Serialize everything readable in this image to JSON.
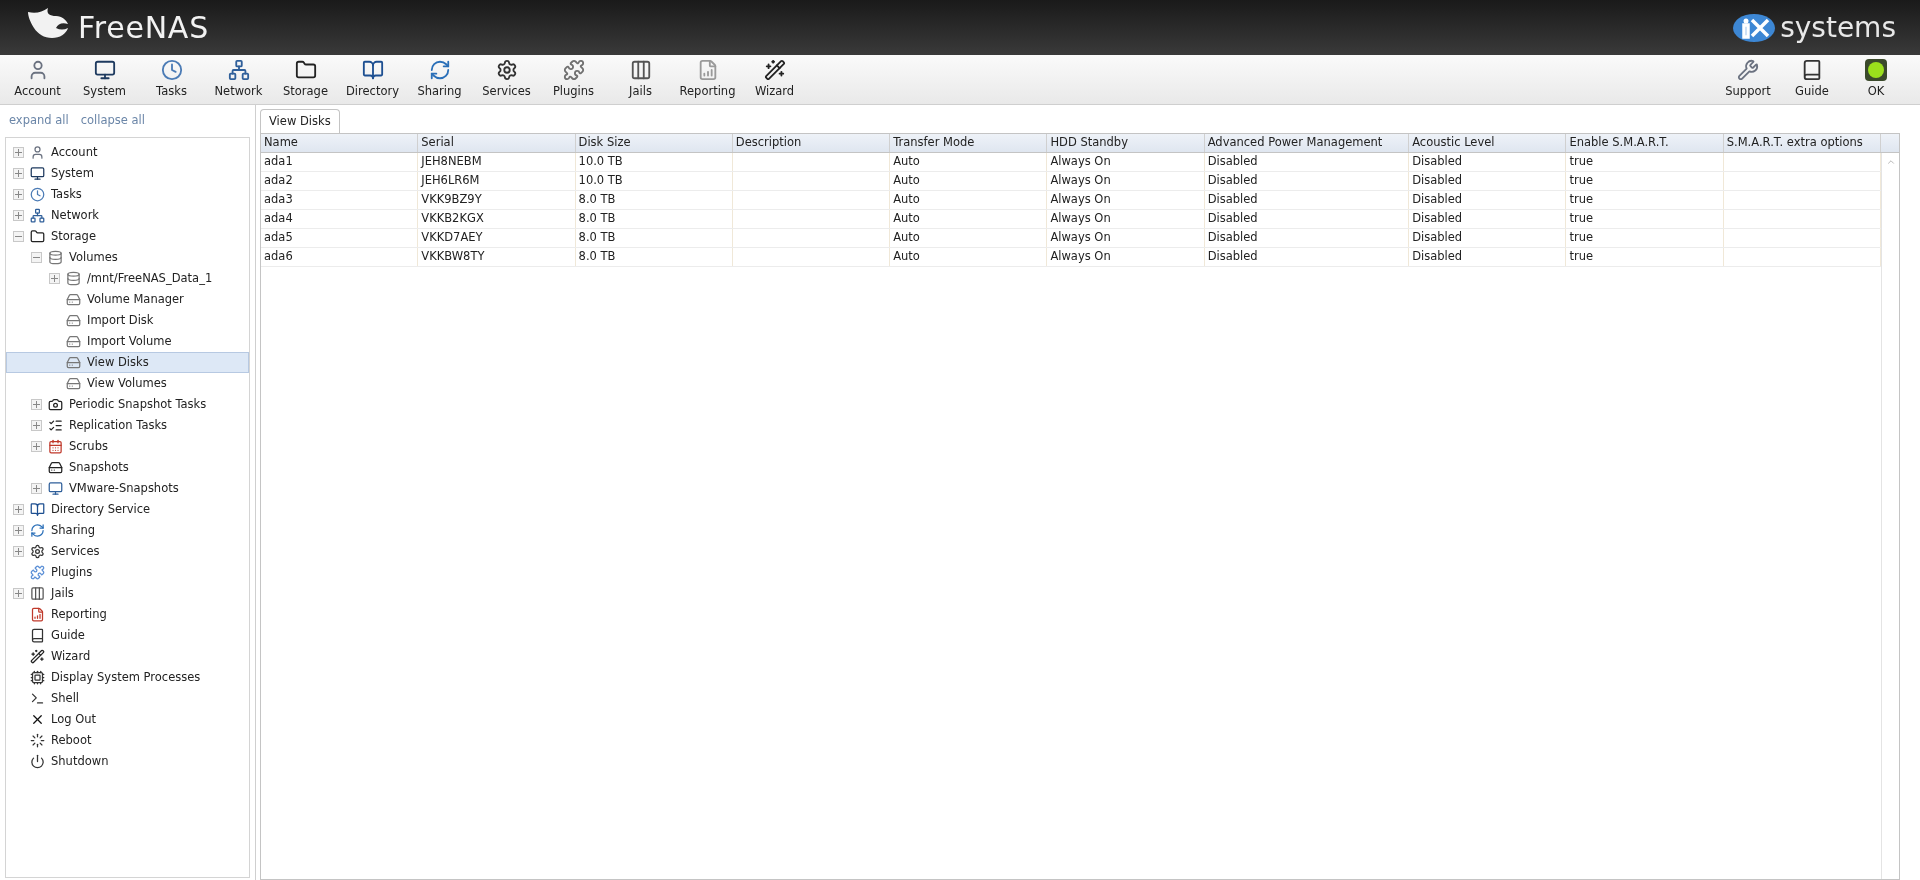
{
  "header": {
    "logo": "FreeNAS",
    "vendor_logo": "systems"
  },
  "toolbar": {
    "items": [
      {
        "label": "Account"
      },
      {
        "label": "System"
      },
      {
        "label": "Tasks"
      },
      {
        "label": "Network"
      },
      {
        "label": "Storage"
      },
      {
        "label": "Directory"
      },
      {
        "label": "Sharing"
      },
      {
        "label": "Services"
      },
      {
        "label": "Plugins"
      },
      {
        "label": "Jails"
      },
      {
        "label": "Reporting"
      },
      {
        "label": "Wizard"
      }
    ],
    "right_items": [
      {
        "label": "Support"
      },
      {
        "label": "Guide"
      },
      {
        "label": "OK"
      }
    ]
  },
  "sidebar": {
    "links": [
      "expand all",
      "collapse all"
    ],
    "tree": [
      {
        "label": "Account",
        "expanded": false,
        "selected": false
      },
      {
        "label": "System",
        "expanded": false,
        "selected": false
      },
      {
        "label": "Tasks",
        "expanded": false,
        "selected": false
      },
      {
        "label": "Network",
        "expanded": false,
        "selected": false
      },
      {
        "label": "Storage",
        "expanded": true,
        "selected": false,
        "children": [
          {
            "label": "Volumes",
            "expanded": true,
            "selected": false,
            "children": [
              {
                "label": "/mnt/FreeNAS_Data_1",
                "expanded": false,
                "selected": false
              },
              {
                "label": "Volume Manager",
                "selected": false
              },
              {
                "label": "Import Disk",
                "selected": false
              },
              {
                "label": "Import Volume",
                "selected": false
              },
              {
                "label": "View Disks",
                "selected": true
              },
              {
                "label": "View Volumes",
                "selected": false
              }
            ]
          },
          {
            "label": "Periodic Snapshot Tasks",
            "expanded": false,
            "selected": false
          },
          {
            "label": "Replication Tasks",
            "expanded": false,
            "selected": false
          },
          {
            "label": "Scrubs",
            "expanded": false,
            "selected": false
          },
          {
            "label": "Snapshots",
            "selected": false
          },
          {
            "label": "VMware-Snapshots",
            "expanded": false,
            "selected": false
          }
        ]
      },
      {
        "label": "Directory Service",
        "expanded": false,
        "selected": false
      },
      {
        "label": "Sharing",
        "expanded": false,
        "selected": false
      },
      {
        "label": "Services",
        "expanded": false,
        "selected": false
      },
      {
        "label": "Plugins",
        "selected": false
      },
      {
        "label": "Jails",
        "expanded": false,
        "selected": false
      },
      {
        "label": "Reporting",
        "selected": false
      },
      {
        "label": "Guide",
        "selected": false
      },
      {
        "label": "Wizard",
        "selected": false
      },
      {
        "label": "Display System Processes",
        "selected": false
      },
      {
        "label": "Shell",
        "selected": false
      },
      {
        "label": "Log Out",
        "selected": false
      },
      {
        "label": "Reboot",
        "selected": false
      },
      {
        "label": "Shutdown",
        "selected": false
      }
    ]
  },
  "tabs": [
    {
      "label": "View Disks",
      "selected": true
    }
  ],
  "table": {
    "columns": [
      "Name",
      "Serial",
      "Disk Size",
      "Description",
      "Transfer Mode",
      "HDD Standby",
      "Advanced Power Management",
      "Acoustic Level",
      "Enable S.M.A.R.T.",
      "S.M.A.R.T. extra options"
    ],
    "rows": [
      [
        "ada1",
        "JEH8NEBM",
        "10.0 TB",
        "",
        "Auto",
        "Always On",
        "Disabled",
        "Disabled",
        "true",
        ""
      ],
      [
        "ada2",
        "JEH6LR6M",
        "10.0 TB",
        "",
        "Auto",
        "Always On",
        "Disabled",
        "Disabled",
        "true",
        ""
      ],
      [
        "ada3",
        "VKK9BZ9Y",
        "8.0 TB",
        "",
        "Auto",
        "Always On",
        "Disabled",
        "Disabled",
        "true",
        ""
      ],
      [
        "ada4",
        "VKKB2KGX",
        "8.0 TB",
        "",
        "Auto",
        "Always On",
        "Disabled",
        "Disabled",
        "true",
        ""
      ],
      [
        "ada5",
        "VKKD7AEY",
        "8.0 TB",
        "",
        "Auto",
        "Always On",
        "Disabled",
        "Disabled",
        "true",
        ""
      ],
      [
        "ada6",
        "VKKBW8TY",
        "8.0 TB",
        "",
        "Auto",
        "Always On",
        "Disabled",
        "Disabled",
        "true",
        ""
      ]
    ]
  }
}
